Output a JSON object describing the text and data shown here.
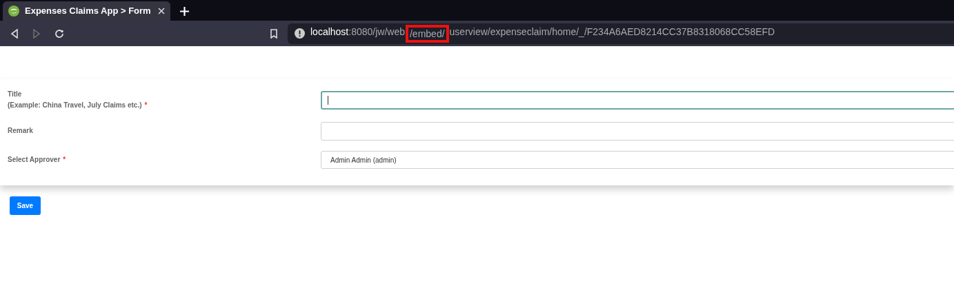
{
  "browser": {
    "tab": {
      "title": "Expenses Claims App > Form",
      "selected": true
    },
    "address": {
      "host": "localhost",
      "path_parts": [
        {
          "text": ":8080/jw/web",
          "highlighted": false
        },
        {
          "text": "/embed/",
          "highlighted": true
        },
        {
          "text": "userview/expenseclaim/home/_/F234A6AED8214CC37B8318068CC58EFD",
          "highlighted": false
        }
      ]
    }
  },
  "form": {
    "fields": [
      {
        "label_lines": [
          "Title",
          "(Example: China Travel, July Claims etc.)"
        ],
        "required_mark": "*",
        "kind": "text",
        "focused": true
      },
      {
        "label_lines": [
          "Remark"
        ],
        "kind": "text",
        "focused": false
      },
      {
        "label_lines": [
          "Select Approver"
        ],
        "required_mark": "*",
        "kind": "select",
        "value": "Admin Admin (admin)",
        "focused": false
      }
    ]
  },
  "buttons": [
    {
      "label": "Save"
    }
  ]
}
